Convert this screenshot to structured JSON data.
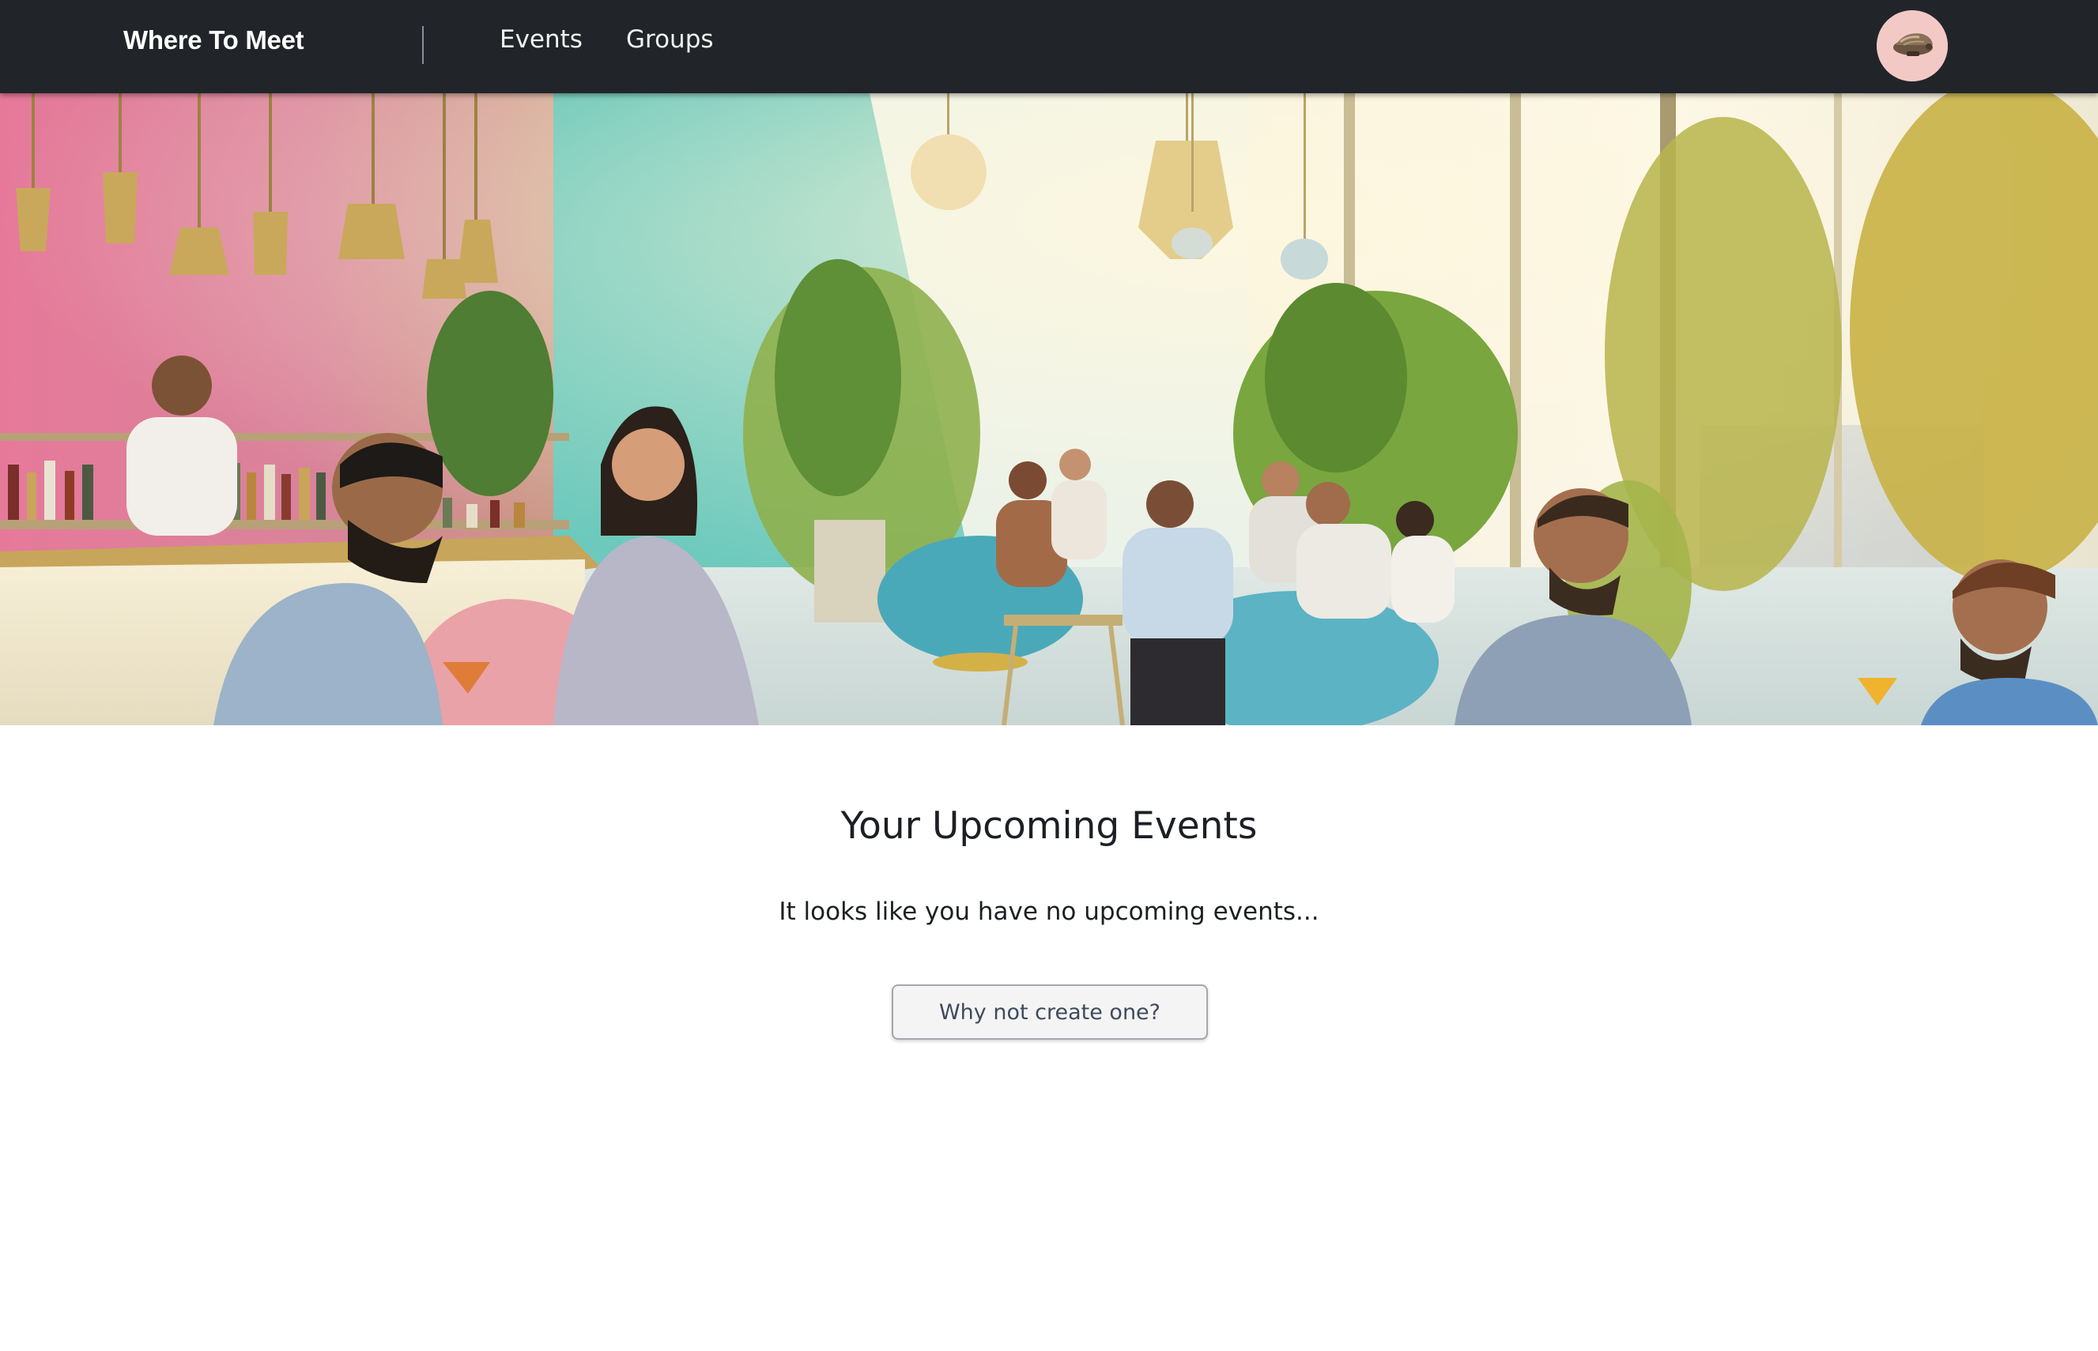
{
  "nav": {
    "brand": "Where To Meet",
    "links": [
      {
        "label": "Events"
      },
      {
        "label": "Groups"
      }
    ],
    "avatar_icon": "user-avatar-icon"
  },
  "hero": {
    "image": "lounge-scene-illustration"
  },
  "main": {
    "title": "Your Upcoming Events",
    "empty_message": "It looks like you have no upcoming events...",
    "create_button_label": "Why not create one?"
  },
  "colors": {
    "navbar_bg": "#212529",
    "nav_text": "#ffffff",
    "avatar_bg": "#f3c9c6",
    "button_bg": "#f4f4f5",
    "button_text": "#3f4a5c"
  }
}
